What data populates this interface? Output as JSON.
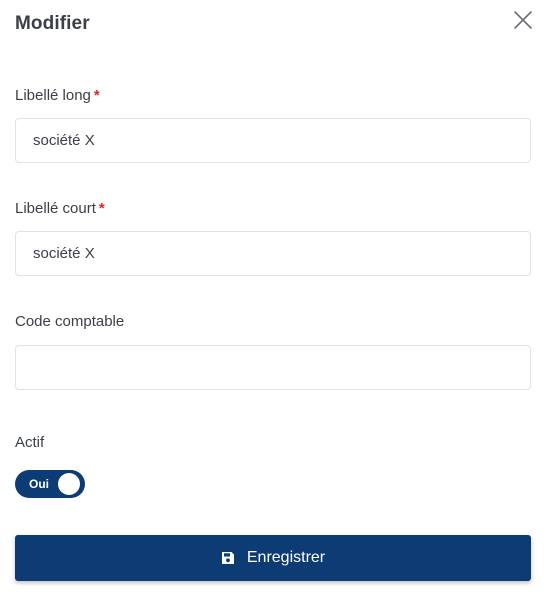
{
  "dialog": {
    "title": "Modifier",
    "close_icon": "close-icon"
  },
  "form": {
    "libelle_long": {
      "label": "Libellé long",
      "required_mark": "*",
      "value": "société X"
    },
    "libelle_court": {
      "label": "Libellé court",
      "required_mark": "*",
      "value": "société X"
    },
    "code_comptable": {
      "label": "Code comptable",
      "value": ""
    },
    "actif": {
      "label": "Actif",
      "toggle_text": "Oui",
      "checked": true
    }
  },
  "actions": {
    "save_icon": "floppy-disk-icon",
    "save_label": "Enregistrer"
  },
  "colors": {
    "primary": "#0d3b73",
    "required": "#e02424",
    "text": "#3b4048",
    "border": "#dfe3e8"
  }
}
